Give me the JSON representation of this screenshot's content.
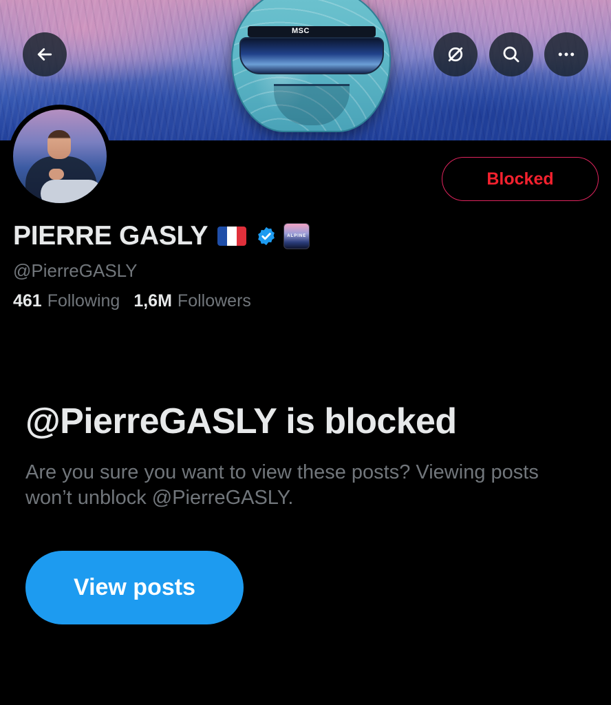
{
  "banner": {
    "visor_text": "MSC"
  },
  "header_buttons": {
    "back_icon": "arrow-left-icon",
    "grok_icon": "grok-slash-icon",
    "search_icon": "search-icon",
    "more_icon": "more-horizontal-icon"
  },
  "profile": {
    "blocked_button_label": "Blocked",
    "display_name": "PIERRE GASLY",
    "flag_icon": "france-flag-icon",
    "verified_icon": "verified-badge-icon",
    "affiliate_icon": "alpine-affiliate-badge-icon",
    "affiliate_text": "ALPINE",
    "handle": "@PierreGASLY",
    "following_count": "461",
    "following_label": "Following",
    "followers_count": "1,6M",
    "followers_label": "Followers"
  },
  "blocked_notice": {
    "title": "@PierreGASLY is blocked",
    "description": "Are you sure you want to view these posts? Viewing posts won’t unblock @PierreGASLY.",
    "view_posts_label": "View posts"
  },
  "colors": {
    "background": "#000000",
    "primary_text": "#e7e9ea",
    "secondary_text": "#71767b",
    "accent_blue": "#1d9bf0",
    "blocked_red": "#f4212e"
  }
}
